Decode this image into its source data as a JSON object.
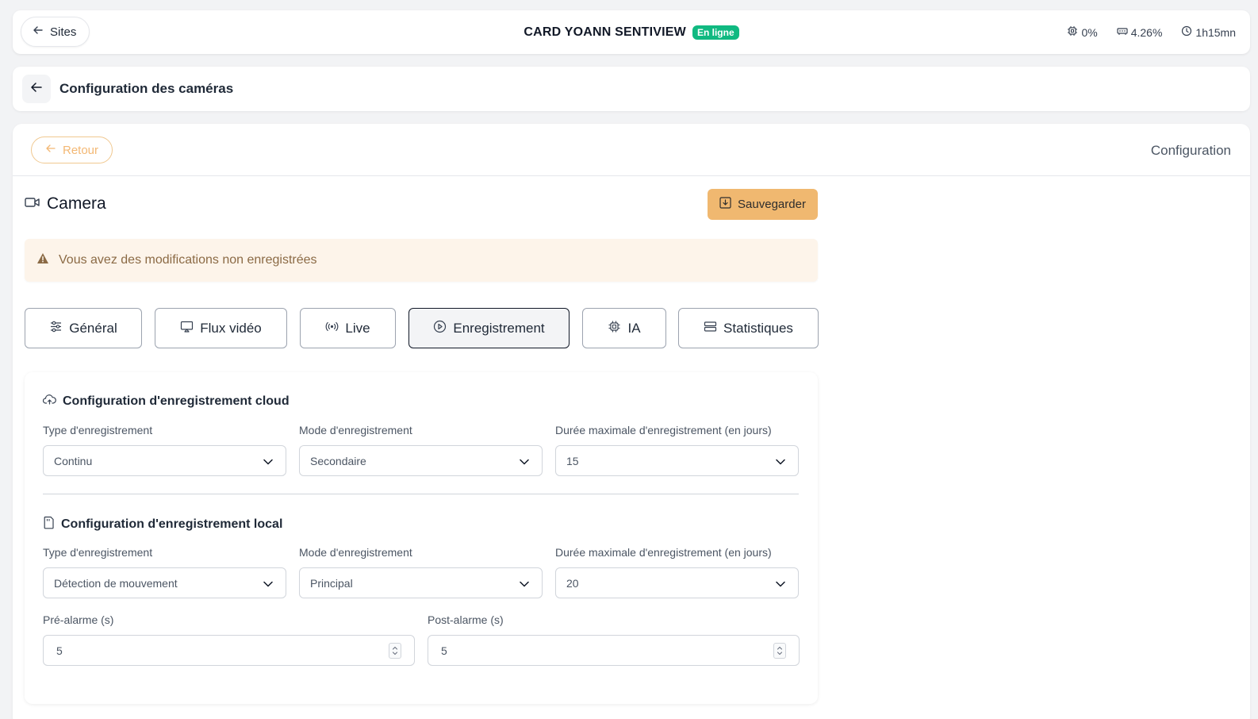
{
  "topbar": {
    "sites_label": "Sites",
    "site_name": "CARD YOANN SENTIVIEW",
    "status_badge": "En ligne",
    "cpu": "0%",
    "memory": "4.26%",
    "uptime": "1h15mn"
  },
  "header": {
    "title": "Configuration des caméras"
  },
  "card": {
    "retour_label": "Retour",
    "config_label": "Configuration",
    "camera_title": "Camera",
    "save_label": "Sauvegarder",
    "warning_text": "Vous avez des modifications non enregistrées"
  },
  "tabs": [
    {
      "label": "Général",
      "icon": "sliders-icon"
    },
    {
      "label": "Flux vidéo",
      "icon": "monitor-icon"
    },
    {
      "label": "Live",
      "icon": "broadcast-icon"
    },
    {
      "label": "Enregistrement",
      "icon": "play-circle-icon",
      "active": true
    },
    {
      "label": "IA",
      "icon": "chip-icon"
    },
    {
      "label": "Statistiques",
      "icon": "server-icon"
    }
  ],
  "cloud": {
    "title": "Configuration d'enregistrement cloud",
    "type_label": "Type d'enregistrement",
    "type_value": "Continu",
    "mode_label": "Mode d'enregistrement",
    "mode_value": "Secondaire",
    "duration_label": "Durée maximale d'enregistrement (en jours)",
    "duration_value": "15"
  },
  "local": {
    "title": "Configuration d'enregistrement local",
    "type_label": "Type d'enregistrement",
    "type_value": "Détection de mouvement",
    "mode_label": "Mode d'enregistrement",
    "mode_value": "Principal",
    "duration_label": "Durée maximale d'enregistrement (en jours)",
    "duration_value": "20",
    "pre_label": "Pré-alarme (s)",
    "pre_value": "5",
    "post_label": "Post-alarme (s)",
    "post_value": "5"
  },
  "colors": {
    "accent": "#f0b870",
    "online": "#10b981",
    "warning_bg": "#fdf4ea"
  }
}
